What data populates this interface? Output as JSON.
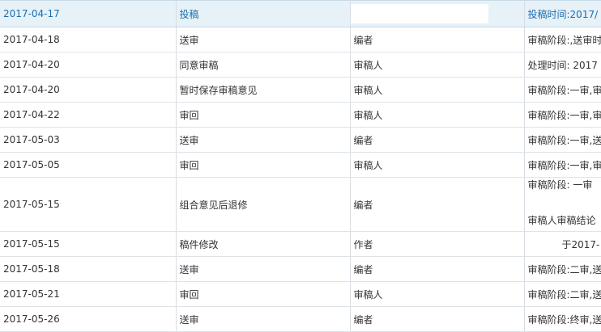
{
  "header": {
    "date": "2017-04-17",
    "action": "投稿",
    "role": "",
    "detail": "投稿时间:2017/"
  },
  "rows": [
    {
      "date": "2017-04-18",
      "action": "送审",
      "role": "编者",
      "detail": "审稿阶段:,送审时"
    },
    {
      "date": "2017-04-20",
      "action": "同意审稿",
      "role": "审稿人",
      "detail": "处理时间: 2017"
    },
    {
      "date": "2017-04-20",
      "action": "暂时保存审稿意见",
      "role": "审稿人",
      "detail": "审稿阶段:一审,审"
    },
    {
      "date": "2017-04-22",
      "action": "审回",
      "role": "审稿人",
      "detail": "审稿阶段:一审,审"
    },
    {
      "date": "2017-05-03",
      "action": "送审",
      "role": "编者",
      "detail": "审稿阶段:一审,送"
    },
    {
      "date": "2017-05-05",
      "action": "审回",
      "role": "审稿人",
      "detail": "审稿阶段:一审,审"
    },
    {
      "date": "2017-05-15",
      "action": "组合意见后退修",
      "role": "编者",
      "detail": "审稿阶段: 一审",
      "detail2": "审稿人审稿结论"
    },
    {
      "date": "2017-05-15",
      "action": "稿件修改",
      "role": "作者",
      "detail": "于2017-"
    },
    {
      "date": "2017-05-18",
      "action": "送审",
      "role": "编者",
      "detail": "审稿阶段:二审,送"
    },
    {
      "date": "2017-05-21",
      "action": "审回",
      "role": "审稿人",
      "detail": "审稿阶段:二审,送"
    },
    {
      "date": "2017-05-26",
      "action": "送审",
      "role": "编者",
      "detail": "审稿阶段:终审,送"
    }
  ]
}
